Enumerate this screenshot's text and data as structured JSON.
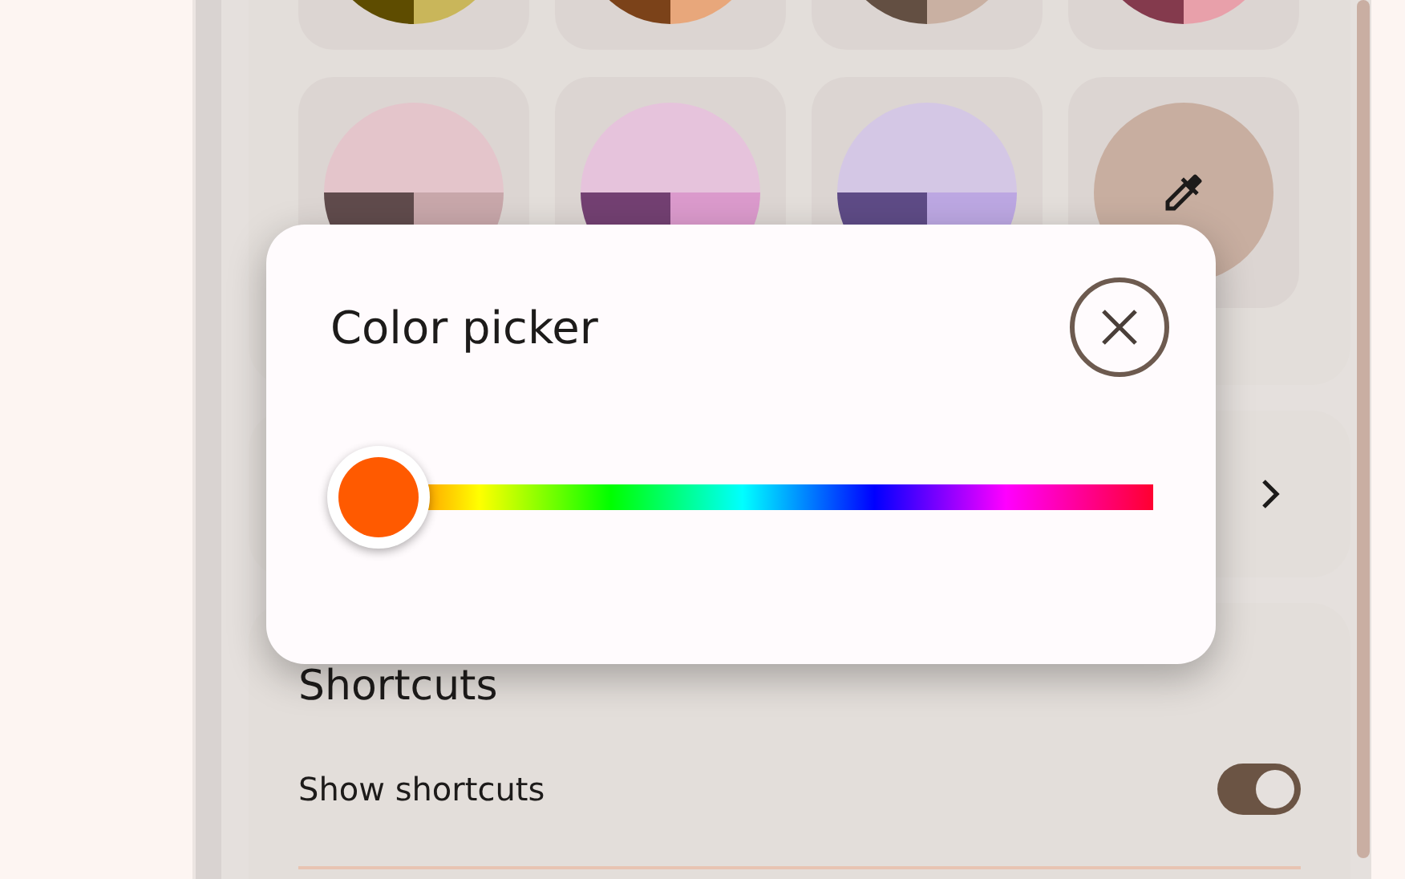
{
  "swatches": [
    {
      "kind": "swatch",
      "segments": [
        {
          "kind": "dark",
          "color": "#5e4c00"
        },
        {
          "kind": "light",
          "color": "#c9b65a"
        }
      ]
    },
    {
      "kind": "swatch",
      "segments": [
        {
          "kind": "dark",
          "color": "#7b4219"
        },
        {
          "kind": "light",
          "color": "#e8a77b"
        }
      ]
    },
    {
      "kind": "swatch",
      "segments": [
        {
          "kind": "dark",
          "color": "#634f42"
        },
        {
          "kind": "light",
          "color": "#c9b0a2"
        }
      ]
    },
    {
      "kind": "swatch",
      "segments": [
        {
          "kind": "dark",
          "color": "#843a4d"
        },
        {
          "kind": "light",
          "color": "#e8a0aa"
        }
      ]
    },
    {
      "kind": "swatch",
      "segments": [
        {
          "kind": "top",
          "color": "#e4c5cb"
        },
        {
          "kind": "dark",
          "color": "#604b4c"
        },
        {
          "kind": "light",
          "color": "#c8a7aa"
        }
      ]
    },
    {
      "kind": "swatch",
      "segments": [
        {
          "kind": "top",
          "color": "#e6c3dc"
        },
        {
          "kind": "dark",
          "color": "#734072"
        },
        {
          "kind": "light",
          "color": "#db9acc"
        }
      ]
    },
    {
      "kind": "swatch",
      "segments": [
        {
          "kind": "top",
          "color": "#d4c7e5"
        },
        {
          "kind": "dark",
          "color": "#5e4b86"
        },
        {
          "kind": "light",
          "color": "#bca7e2"
        }
      ]
    },
    {
      "kind": "eyedropper",
      "color": "#c8aea0"
    }
  ],
  "shortcuts": {
    "title": "Shortcuts",
    "items": [
      {
        "label": "Show shortcuts",
        "on": true
      }
    ]
  },
  "dialog": {
    "title": "Color picker",
    "slider": {
      "color": "#ff5a00"
    }
  }
}
